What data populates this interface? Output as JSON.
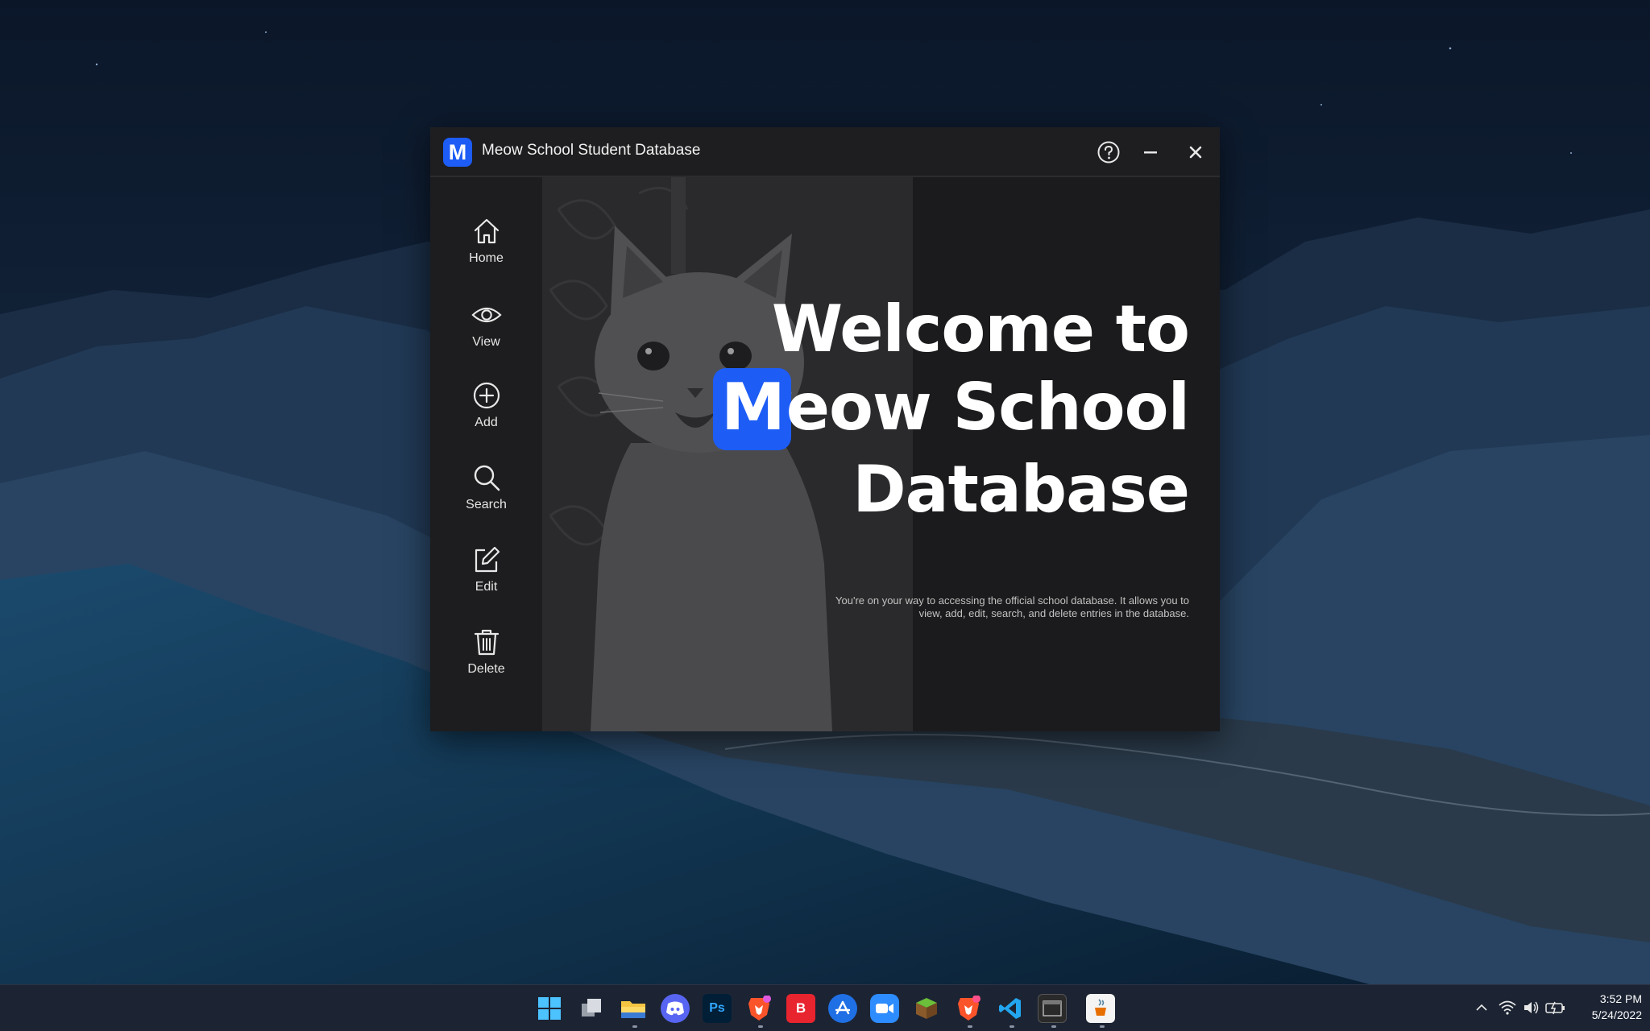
{
  "window": {
    "title": "Meow School Student Database",
    "logo_letter": "M"
  },
  "sidebar": {
    "items": [
      {
        "label": "Home",
        "icon": "home-icon"
      },
      {
        "label": "View",
        "icon": "eye-icon"
      },
      {
        "label": "Add",
        "icon": "plus-circle-icon"
      },
      {
        "label": "Search",
        "icon": "search-icon"
      },
      {
        "label": "Edit",
        "icon": "edit-icon"
      },
      {
        "label": "Delete",
        "icon": "trash-icon"
      }
    ]
  },
  "hero": {
    "line1": "Welcome to",
    "line2_badge": "M",
    "line2_rest": "eow School",
    "line3": "Database",
    "blurb": "You're on your way to accessing the official school database. It allows you to view, add, edit, search, and delete entries in the database."
  },
  "taskbar": {
    "apps": [
      "start",
      "task-view",
      "file-explorer",
      "discord",
      "photoshop",
      "brave",
      "bitwarden",
      "app-store",
      "zoom",
      "minecraft",
      "brave-beta",
      "vscode",
      "terminal",
      "java"
    ],
    "time": "3:52 PM",
    "date": "5/24/2022"
  },
  "colors": {
    "accent": "#1d5cf5",
    "window_bg": "#1a1a1c",
    "text": "#ffffff"
  }
}
